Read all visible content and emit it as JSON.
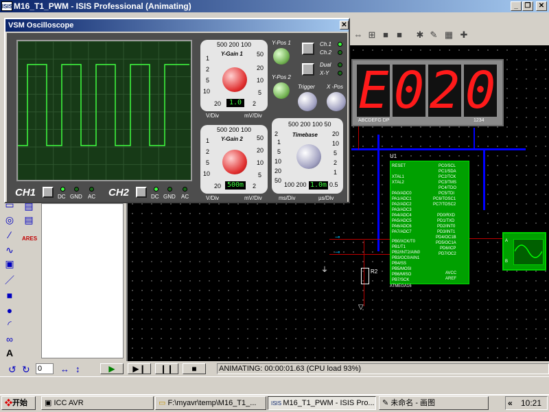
{
  "window": {
    "app_icon_text": "ISIS",
    "title": "M16_T1_PWM - ISIS Professional (Animating)"
  },
  "oscilloscope": {
    "title": "VSM Oscilloscope",
    "ch1_label": "CH1",
    "ch2_label": "CH2",
    "coupling": [
      "DC",
      "GND",
      "AC"
    ],
    "ygain1": {
      "title": "Y-Gain 1",
      "top_scale": "500 200 100",
      "left_scale": [
        "1",
        "2",
        "5",
        "10",
        "20"
      ],
      "right_scale": [
        "50",
        "20",
        "10",
        "5",
        "2"
      ],
      "value": "1.0",
      "unit_left": "V/Div",
      "unit_right": "mV/Div"
    },
    "ygain2": {
      "title": "Y-Gain 2",
      "top_scale": "500 200 100",
      "left_scale": [
        "1",
        "2",
        "5",
        "10",
        "20"
      ],
      "right_scale": [
        "50",
        "20",
        "10",
        "5",
        "2"
      ],
      "value": "500m",
      "unit_left": "V/Div",
      "unit_right": "mV/Div"
    },
    "ypos1": "Y-Pos 1",
    "ypos2": "Y-Pos 2",
    "ch_labels": [
      "Ch.1",
      "Ch.2"
    ],
    "dual_xy": [
      "Dual",
      "X-Y"
    ],
    "trigger": "Trigger",
    "xpos": "X -Pos",
    "timebase": {
      "title": "Timebase",
      "top_scale": "500 200 100 50",
      "left_scale": [
        "2",
        "1",
        "5",
        "10",
        "20",
        "50"
      ],
      "right_scale": [
        "20",
        "10",
        "5",
        "2",
        "1"
      ],
      "bottom_scale": "100 200",
      "extra": "0.5",
      "value": "1.0m",
      "unit_left": "ms/Div",
      "unit_right": "µs/Div"
    }
  },
  "display": {
    "digits": [
      "E",
      "0",
      "2",
      "0"
    ],
    "caption_left": "ABCDEFG  DP",
    "caption_right": "1234"
  },
  "mcu": {
    "ref": "U1",
    "part": "ATMEGA16",
    "left_pins": [
      "RESET",
      "",
      "XTAL1",
      "XTAL2",
      "",
      "PA0/ADC0",
      "PA1/ADC1",
      "PA2/ADC2",
      "PA3/ADC3",
      "PA4/ADC4",
      "PA5/ADC5",
      "PA6/ADC6",
      "PA7/ADC7",
      "",
      "PB0/XCK/T0",
      "PB1/T1",
      "PB2/INT2/AIN0",
      "PB3/OC0/AIN1",
      "PB4/SS",
      "PB5/MOSI",
      "PB6/MISO",
      "PB7/SCK"
    ],
    "right_pins": [
      "PC0/SCL",
      "PC1/SDA",
      "PC2/TCK",
      "PC3/TMS",
      "PC4/TDO",
      "PC5/TDI",
      "PC6/TOSC1",
      "PC7/TOSC2",
      "",
      "PD0/RXD",
      "PD1/TXD",
      "PD2/INT0",
      "PD3/INT1",
      "PD4/OC1B",
      "PD5/OC1A",
      "PD6/ICP",
      "PD7/OC2",
      "",
      "AVCC",
      "AREF"
    ]
  },
  "resistor": {
    "ref": "R2"
  },
  "bottom": {
    "rotation_value": "0",
    "status": "ANIMATING: 00:00:01.63 (CPU load 93%)"
  },
  "taskbar": {
    "start": "开始",
    "tasks": [
      "ICC AVR",
      "F:\\myavr\\temp\\M16_T1_...",
      "M16_T1_PWM - ISIS Pro...",
      "未命名 - 画图"
    ],
    "arrows": "«",
    "clock": "10:21"
  },
  "colors": {
    "titlebar": "#0a246a",
    "trace": "#40ff40",
    "segment": "#ff1a1a",
    "mcu_body": "#00a000",
    "bus": "#0000ff"
  }
}
